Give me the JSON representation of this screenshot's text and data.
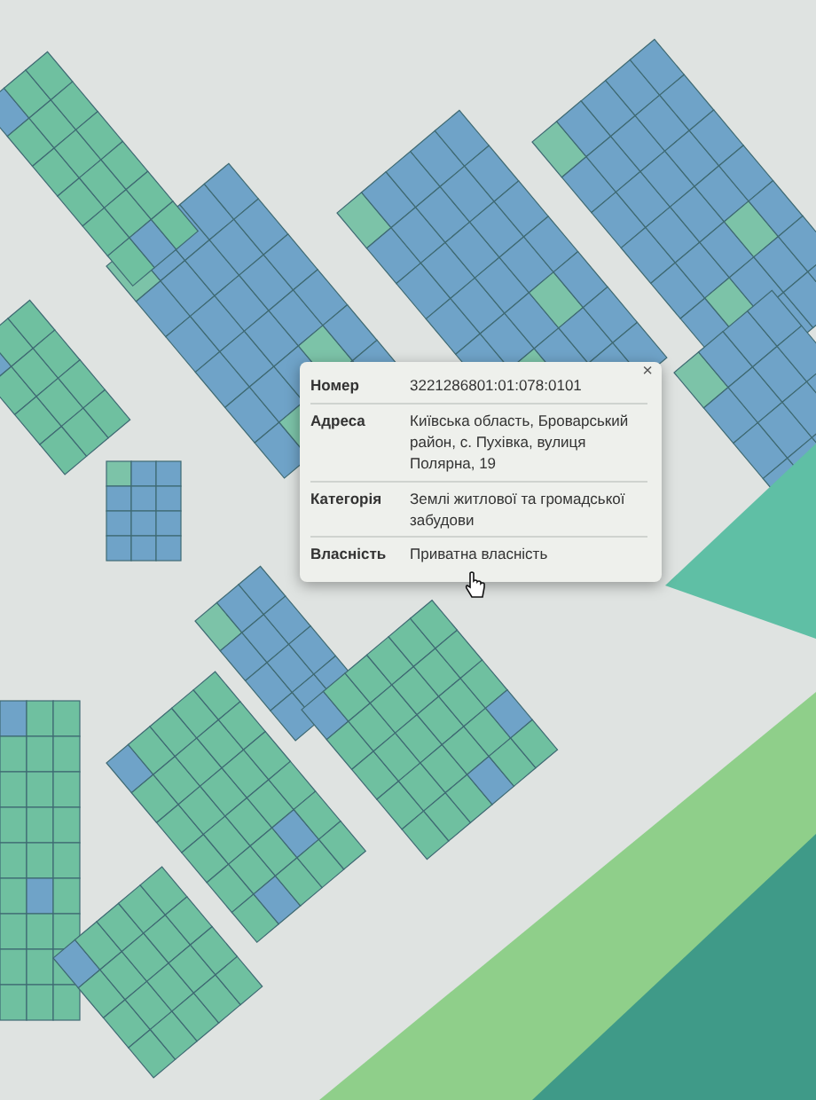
{
  "popup": {
    "close": "×",
    "rows": [
      {
        "label": "Номер",
        "value": "3221286801:01:078:0101"
      },
      {
        "label": "Адреса",
        "value": "Київська область, Броварський район, с. Пухівка, вулиця Полярна, 19"
      },
      {
        "label": "Категорія",
        "value": "Землі житлової та громадської забудови"
      },
      {
        "label": "Власність",
        "value": "Приватна власність"
      }
    ]
  }
}
